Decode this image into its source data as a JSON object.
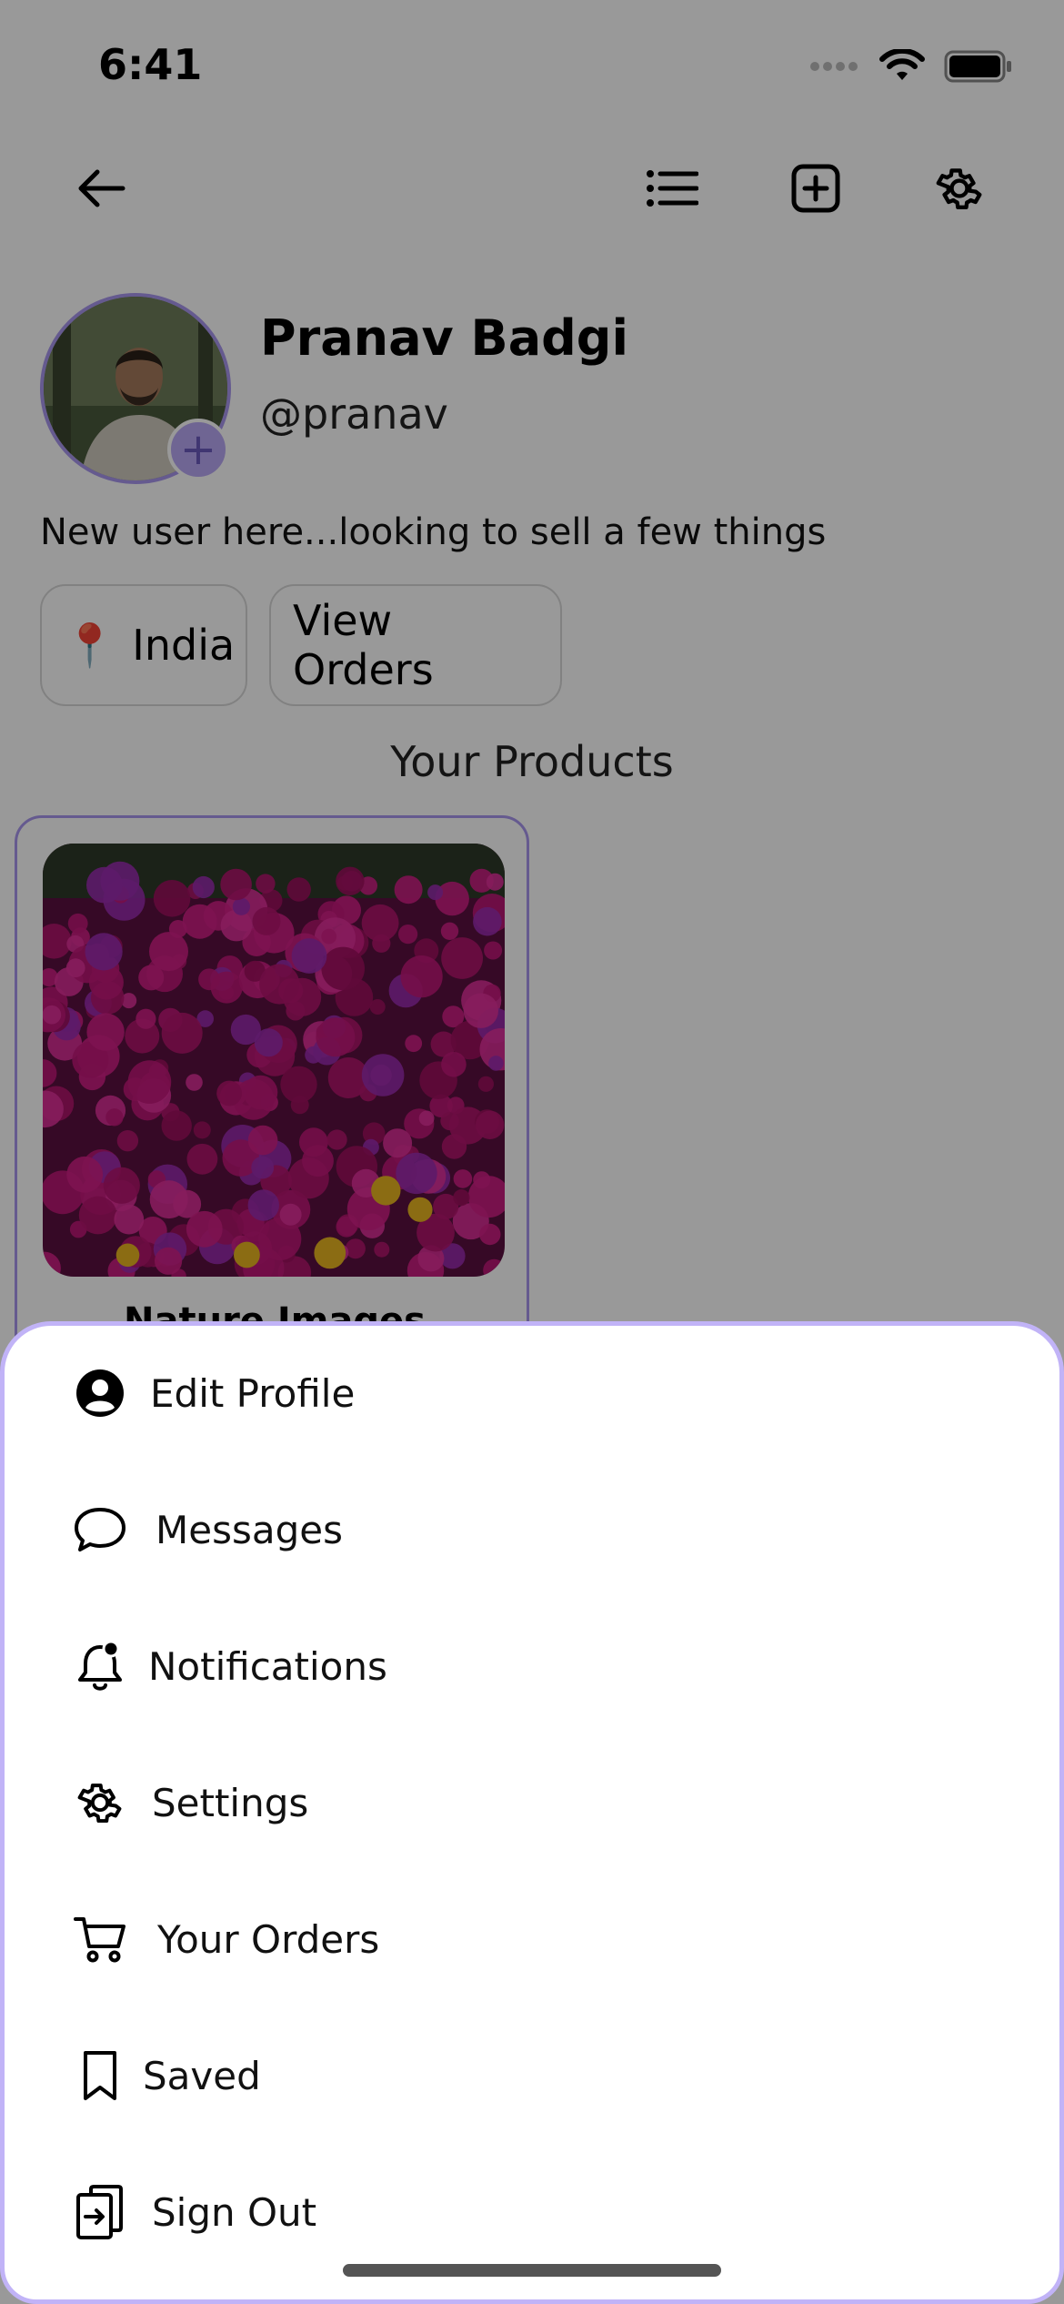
{
  "status_bar": {
    "time": "6:41"
  },
  "profile": {
    "name": "Pranav Badgi",
    "handle": "@pranav",
    "bio": "New user here...looking to sell a few things",
    "location_icon": "📍",
    "location": "India",
    "view_orders_label": "View Orders"
  },
  "products": {
    "section_title": "Your Products",
    "items": [
      {
        "name": "Nature Images"
      }
    ]
  },
  "menu": {
    "items": [
      {
        "label": "Edit Profile",
        "icon": "user-circle-icon"
      },
      {
        "label": "Messages",
        "icon": "chat-bubble-icon"
      },
      {
        "label": "Notifications",
        "icon": "bell-icon"
      },
      {
        "label": "Settings",
        "icon": "gear-icon"
      },
      {
        "label": "Your Orders",
        "icon": "cart-icon"
      },
      {
        "label": "Saved",
        "icon": "bookmark-icon"
      },
      {
        "label": "Sign Out",
        "icon": "sign-out-icon"
      }
    ]
  },
  "colors": {
    "accent": "#a896ee",
    "overlay": "rgba(0,0,0,0.40)"
  }
}
